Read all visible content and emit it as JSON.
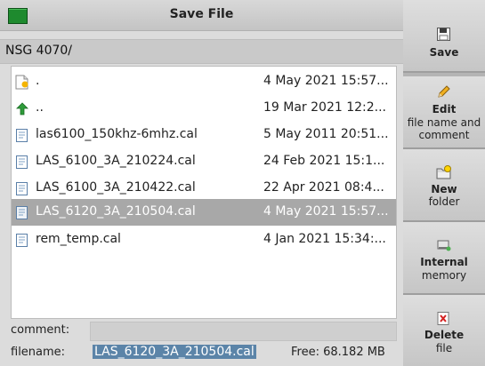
{
  "window": {
    "title": "Save File"
  },
  "path": "NSG 4070/",
  "files": [
    {
      "name": ".",
      "date": "4 May 2021 15:57...",
      "icon": "current-folder-icon",
      "selected": false
    },
    {
      "name": "..",
      "date": "19 Mar 2021 12:2...",
      "icon": "parent-folder-icon",
      "selected": false
    },
    {
      "name": "las6100_150khz-6mhz.cal",
      "date": "5 May 2011 20:51...",
      "icon": "file-icon",
      "selected": false
    },
    {
      "name": "LAS_6100_3A_210224.cal",
      "date": "24 Feb 2021 15:1...",
      "icon": "file-icon",
      "selected": false
    },
    {
      "name": "LAS_6100_3A_210422.cal",
      "date": "22 Apr 2021 08:4...",
      "icon": "file-icon",
      "selected": false
    },
    {
      "name": "LAS_6120_3A_210504.cal",
      "date": "4 May 2021 15:57...",
      "icon": "file-icon",
      "selected": true
    },
    {
      "name": "rem_temp.cal",
      "date": "4 Jan 2021 15:34:...",
      "icon": "file-icon",
      "selected": false
    }
  ],
  "footer": {
    "comment_label": "comment:",
    "comment_value": "",
    "filename_label": "filename:",
    "filename_value": "LAS_6120_3A_210504.cal",
    "free_space": "Free: 68.182 MB"
  },
  "sidebar": {
    "save": {
      "label": "Save",
      "icon": "floppy-disk-icon"
    },
    "edit": {
      "label": "Edit",
      "sub": "file name and comment",
      "sub1": "file name and",
      "sub2": "comment",
      "icon": "pencil-icon"
    },
    "new_folder": {
      "label": "New",
      "sub": "folder",
      "icon": "new-folder-icon"
    },
    "internal": {
      "label": "Internal",
      "sub": "memory",
      "icon": "internal-drive-icon"
    },
    "delete": {
      "label": "Delete",
      "sub": "file",
      "icon": "delete-file-icon"
    }
  },
  "colors": {
    "selection": "#a8a8a8",
    "filename_highlight": "#5b84a8",
    "title_indicator": "#1e8a2e"
  }
}
